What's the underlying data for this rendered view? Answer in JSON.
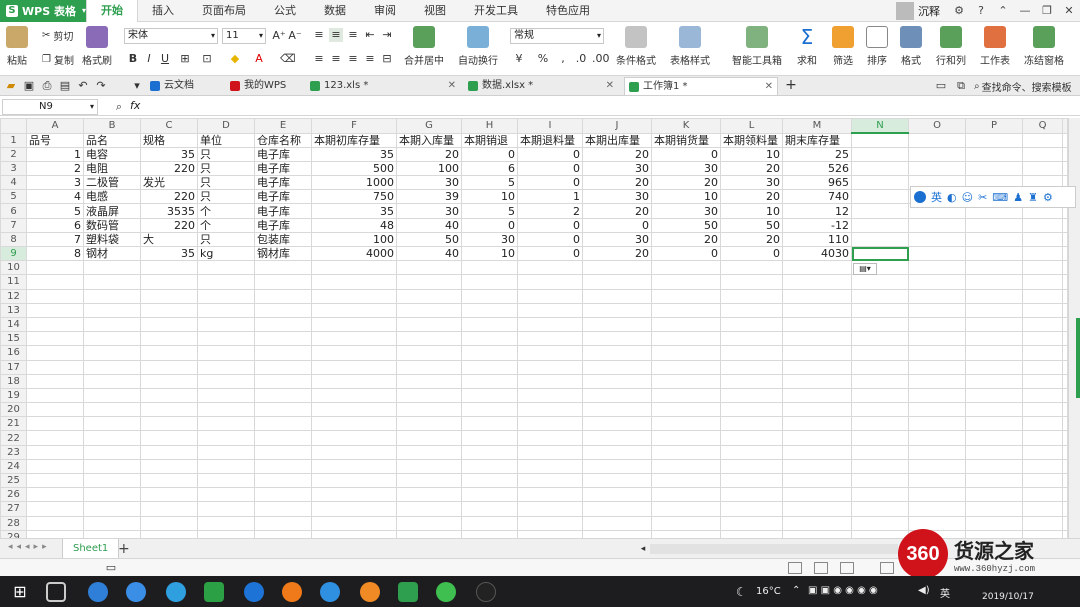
{
  "app": {
    "name": "WPS 表格",
    "brand_color": "#2e9e4f"
  },
  "menu": {
    "tabs": [
      "开始",
      "插入",
      "页面布局",
      "公式",
      "数据",
      "审阅",
      "视图",
      "开发工具",
      "特色应用"
    ],
    "active_tab": "开始",
    "user_name": "沉释"
  },
  "ribbon": {
    "paste": "粘贴",
    "cut": "剪切",
    "copy": "复制",
    "format_painter": "格式刷",
    "font_name": "宋体",
    "font_size": "11",
    "merge_center": "合并居中",
    "wrap_text": "自动换行",
    "number_format": "常规",
    "conditional_format": "条件格式",
    "table_style": "表格样式",
    "smart_toolbox": "智能工具箱",
    "sum": "求和",
    "filter": "筛选",
    "sort": "排序",
    "format": "格式",
    "row_col": "行和列",
    "worksheet": "工作表",
    "freeze": "冻结窗格"
  },
  "doc_tabs": {
    "items": [
      "云文档",
      "我的WPS",
      "123.xls *",
      "数据.xlsx *",
      "工作簿1 *"
    ],
    "active": "工作簿1 *",
    "search_hint": "查找命令、搜索模板"
  },
  "formula_bar": {
    "name_box": "N9",
    "fx": "fx",
    "value": ""
  },
  "grid": {
    "columns": [
      "A",
      "B",
      "C",
      "D",
      "E",
      "F",
      "G",
      "H",
      "I",
      "J",
      "K",
      "L",
      "M",
      "N",
      "O",
      "P",
      "Q"
    ],
    "selected_column": "N",
    "selected_row": 9,
    "row_count": 29,
    "header_row": [
      "品号",
      "品名",
      "规格",
      "单位",
      "仓库名称",
      "本期初库存量",
      "本期入库量",
      "本期销退",
      "本期退料量",
      "本期出库量",
      "本期销货量",
      "本期领料量",
      "期末库存量"
    ],
    "rows": [
      [
        "1",
        "电容",
        "35",
        "只",
        "电子库",
        "35",
        "20",
        "0",
        "0",
        "20",
        "0",
        "10",
        "25"
      ],
      [
        "2",
        "电阻",
        "220",
        "只",
        "电子库",
        "500",
        "100",
        "6",
        "0",
        "30",
        "30",
        "20",
        "526"
      ],
      [
        "3",
        "二极管",
        "发光",
        "只",
        "电子库",
        "1000",
        "30",
        "5",
        "0",
        "20",
        "20",
        "30",
        "965"
      ],
      [
        "4",
        "电感",
        "220",
        "只",
        "电子库",
        "750",
        "39",
        "10",
        "1",
        "30",
        "10",
        "20",
        "740"
      ],
      [
        "5",
        "液晶屏",
        "3535",
        "个",
        "电子库",
        "35",
        "30",
        "5",
        "2",
        "20",
        "30",
        "10",
        "12"
      ],
      [
        "6",
        "数码管",
        "220",
        "个",
        "电子库",
        "48",
        "40",
        "0",
        "0",
        "0",
        "50",
        "50",
        "-12"
      ],
      [
        "7",
        "塑料袋",
        "大",
        "只",
        "包装库",
        "100",
        "50",
        "30",
        "0",
        "30",
        "20",
        "20",
        "110"
      ],
      [
        "8",
        "钢材",
        "35",
        "kg",
        "钢材库",
        "4000",
        "40",
        "10",
        "0",
        "20",
        "0",
        "0",
        "4030"
      ]
    ]
  },
  "ime_bar": {
    "lang": "英"
  },
  "sheets": {
    "items": [
      "Sheet1"
    ],
    "active": "Sheet1"
  },
  "watermark": {
    "badge": "360",
    "name": "货源之家",
    "url": "www.360hyzj.com"
  },
  "taskbar": {
    "temperature": "16°C",
    "ime": "英",
    "date": "2019/10/17"
  }
}
